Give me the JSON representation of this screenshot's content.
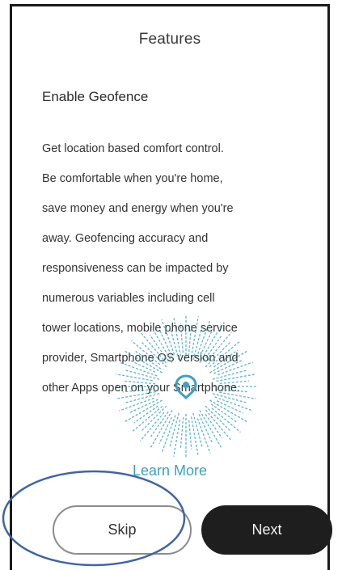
{
  "header": {
    "title": "Features"
  },
  "section": {
    "heading": "Enable Geofence",
    "body_lines": [
      "Get location based comfort control.",
      "Be comfortable when you're home,",
      "save money and energy when you're",
      "away. Geofencing accuracy and",
      "responsiveness can be impacted by",
      "numerous variables including cell",
      "tower locations, mobile phone service",
      "provider, Smartphone OS version and",
      "other Apps open on your Smartphone."
    ]
  },
  "graphic": {
    "icon": "location-pin-icon",
    "accent_color": "#3aa2c4"
  },
  "links": {
    "learn_more": "Learn More"
  },
  "actions": {
    "skip_label": "Skip",
    "next_label": "Next"
  },
  "colors": {
    "accent": "#3aa2c4",
    "next_button_bg": "#1e1e1e",
    "highlight_outline": "#3f64a8"
  }
}
